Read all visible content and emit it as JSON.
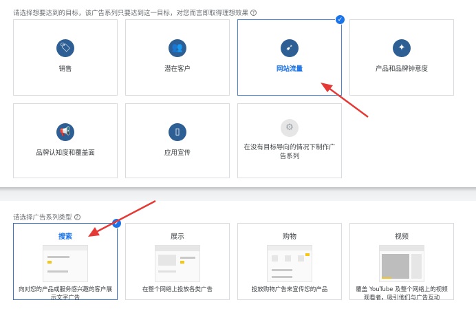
{
  "goal_section": {
    "prompt": "请选择想要达到的目标，该广告系列只要达到这一目标，对您而言即取得理想效果",
    "help_icon": "?",
    "goals": [
      {
        "label": "销售",
        "icon": "tag-icon",
        "glyph": "🏷"
      },
      {
        "label": "潜在客户",
        "icon": "people-icon",
        "glyph": "👥"
      },
      {
        "label": "网站流量",
        "icon": "cursor-click-icon",
        "glyph": "➹",
        "selected": true
      },
      {
        "label": "产品和品牌钟意度",
        "icon": "sparkle-icon",
        "glyph": "✦"
      },
      {
        "label": "品牌认知度和覆盖面",
        "icon": "megaphone-icon",
        "glyph": "📢"
      },
      {
        "label": "应用宣传",
        "icon": "phone-icon",
        "glyph": "▯"
      },
      {
        "label": "在没有目标导向的情况下制作广告系列",
        "icon": "gear-icon",
        "glyph": "⚙"
      }
    ]
  },
  "type_section": {
    "prompt": "请选择广告系列类型",
    "help_icon": "?",
    "types": [
      {
        "title": "搜索",
        "desc": "向对您的产品或服务感兴趣的客户展示文字广告",
        "selected": true
      },
      {
        "title": "展示",
        "desc": "在整个网络上投放各类广告"
      },
      {
        "title": "购物",
        "desc": "投放购物广告来宣传您的产品"
      },
      {
        "title": "视频",
        "desc": "覆盖 YouTube 及整个网络上的视频观看者，吸引他们与广告互动"
      }
    ]
  },
  "check_glyph": "✓",
  "colors": {
    "accent": "#1a73e8",
    "icon_bg": "#2d5f94",
    "arrow": "#e53935"
  }
}
